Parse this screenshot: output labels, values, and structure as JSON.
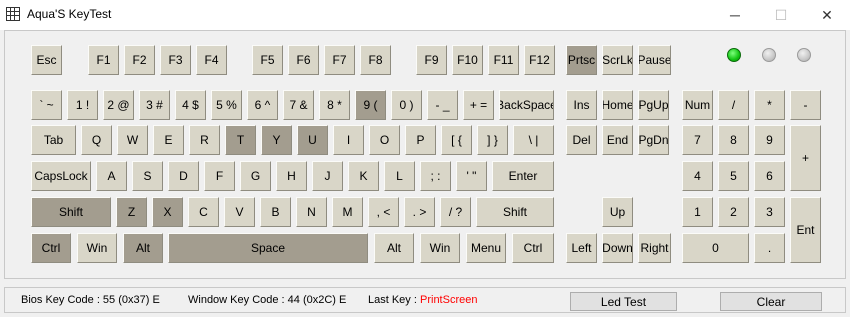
{
  "window": {
    "title": "Aqua'S KeyTest",
    "app_icon": "grid-icon",
    "controls": {
      "minimize": "─",
      "maximize": "☐",
      "close": "✕"
    }
  },
  "colors": {
    "key": "#d9d6c8",
    "key_pressed": "#a39d8f",
    "led_on": "#12c412",
    "led_off": "#c8c8c8",
    "last_key": "#ff0000"
  },
  "leds": [
    {
      "name": "led-1",
      "on": true
    },
    {
      "name": "led-2",
      "on": false
    },
    {
      "name": "led-3",
      "on": false
    }
  ],
  "keys": [
    {
      "label": "Esc",
      "pressed": false
    },
    {
      "label": "F1",
      "pressed": false
    },
    {
      "label": "F2",
      "pressed": false
    },
    {
      "label": "F3",
      "pressed": false
    },
    {
      "label": "F4",
      "pressed": false
    },
    {
      "label": "F5",
      "pressed": false
    },
    {
      "label": "F6",
      "pressed": false
    },
    {
      "label": "F7",
      "pressed": false
    },
    {
      "label": "F8",
      "pressed": false
    },
    {
      "label": "F9",
      "pressed": false
    },
    {
      "label": "F10",
      "pressed": false
    },
    {
      "label": "F11",
      "pressed": false
    },
    {
      "label": "F12",
      "pressed": false
    },
    {
      "label": "Prtsc",
      "pressed": true
    },
    {
      "label": "ScrLk",
      "pressed": false
    },
    {
      "label": "Pause",
      "pressed": false
    },
    {
      "label": "` ~",
      "pressed": false
    },
    {
      "label": "1 !",
      "pressed": false
    },
    {
      "label": "2 @",
      "pressed": false
    },
    {
      "label": "3 #",
      "pressed": false
    },
    {
      "label": "4 $",
      "pressed": false
    },
    {
      "label": "5 %",
      "pressed": false
    },
    {
      "label": "6 ^",
      "pressed": false
    },
    {
      "label": "7 &",
      "pressed": false
    },
    {
      "label": "8 *",
      "pressed": false
    },
    {
      "label": "9 (",
      "pressed": true
    },
    {
      "label": "0 )",
      "pressed": false
    },
    {
      "label": "- _",
      "pressed": false
    },
    {
      "label": "+ =",
      "pressed": false
    },
    {
      "label": "BackSpace",
      "pressed": false
    },
    {
      "label": "Ins",
      "pressed": false
    },
    {
      "label": "Home",
      "pressed": false
    },
    {
      "label": "PgUp",
      "pressed": false
    },
    {
      "label": "Num",
      "pressed": false
    },
    {
      "label": "/",
      "pressed": false
    },
    {
      "label": "*",
      "pressed": false
    },
    {
      "label": "-",
      "pressed": false
    },
    {
      "label": "Tab",
      "pressed": false
    },
    {
      "label": "Q",
      "pressed": false
    },
    {
      "label": "W",
      "pressed": false
    },
    {
      "label": "E",
      "pressed": false
    },
    {
      "label": "R",
      "pressed": false
    },
    {
      "label": "T",
      "pressed": true
    },
    {
      "label": "Y",
      "pressed": true
    },
    {
      "label": "U",
      "pressed": true
    },
    {
      "label": "I",
      "pressed": false
    },
    {
      "label": "O",
      "pressed": false
    },
    {
      "label": "P",
      "pressed": false
    },
    {
      "label": "[ {",
      "pressed": false
    },
    {
      "label": "] }",
      "pressed": false
    },
    {
      "label": "\\ |",
      "pressed": false
    },
    {
      "label": "Del",
      "pressed": false
    },
    {
      "label": "End",
      "pressed": false
    },
    {
      "label": "PgDn",
      "pressed": false
    },
    {
      "label": "7",
      "pressed": false
    },
    {
      "label": "8",
      "pressed": false
    },
    {
      "label": "9",
      "pressed": false
    },
    {
      "label": "+",
      "pressed": false
    },
    {
      "label": "CapsLock",
      "pressed": false
    },
    {
      "label": "A",
      "pressed": false
    },
    {
      "label": "S",
      "pressed": false
    },
    {
      "label": "D",
      "pressed": false
    },
    {
      "label": "F",
      "pressed": false
    },
    {
      "label": "G",
      "pressed": false
    },
    {
      "label": "H",
      "pressed": false
    },
    {
      "label": "J",
      "pressed": false
    },
    {
      "label": "K",
      "pressed": false
    },
    {
      "label": "L",
      "pressed": false
    },
    {
      "label": "; :",
      "pressed": false
    },
    {
      "label": "' \"",
      "pressed": false
    },
    {
      "label": "Enter",
      "pressed": false
    },
    {
      "label": "4",
      "pressed": false
    },
    {
      "label": "5",
      "pressed": false
    },
    {
      "label": "6",
      "pressed": false
    },
    {
      "label": "Shift",
      "pressed": true
    },
    {
      "label": "Z",
      "pressed": true
    },
    {
      "label": "X",
      "pressed": true
    },
    {
      "label": "C",
      "pressed": false
    },
    {
      "label": "V",
      "pressed": false
    },
    {
      "label": "B",
      "pressed": false
    },
    {
      "label": "N",
      "pressed": false
    },
    {
      "label": "M",
      "pressed": false
    },
    {
      "label": ", <",
      "pressed": false
    },
    {
      "label": ". >",
      "pressed": false
    },
    {
      "label": "/ ?",
      "pressed": false
    },
    {
      "label": "Shift",
      "pressed": false
    },
    {
      "label": "Up",
      "pressed": false
    },
    {
      "label": "1",
      "pressed": false
    },
    {
      "label": "2",
      "pressed": false
    },
    {
      "label": "3",
      "pressed": false
    },
    {
      "label": "Ent",
      "pressed": false
    },
    {
      "label": "Ctrl",
      "pressed": true
    },
    {
      "label": "Win",
      "pressed": false
    },
    {
      "label": "Alt",
      "pressed": true
    },
    {
      "label": "Space",
      "pressed": true
    },
    {
      "label": "Alt",
      "pressed": false
    },
    {
      "label": "Win",
      "pressed": false
    },
    {
      "label": "Menu",
      "pressed": false
    },
    {
      "label": "Ctrl",
      "pressed": false
    },
    {
      "label": "Left",
      "pressed": false
    },
    {
      "label": "Down",
      "pressed": false
    },
    {
      "label": "Right",
      "pressed": false
    },
    {
      "label": "0",
      "pressed": false
    },
    {
      "label": ".",
      "pressed": false
    }
  ],
  "status": {
    "bios_key_code": "Bios Key Code : 55 (0x37) E",
    "window_key_code": "Window Key Code : 44 (0x2C) E",
    "last_key_label": "Last Key :",
    "last_key_value": "PrintScreen",
    "led_test_button": "Led Test",
    "clear_button": "Clear"
  }
}
